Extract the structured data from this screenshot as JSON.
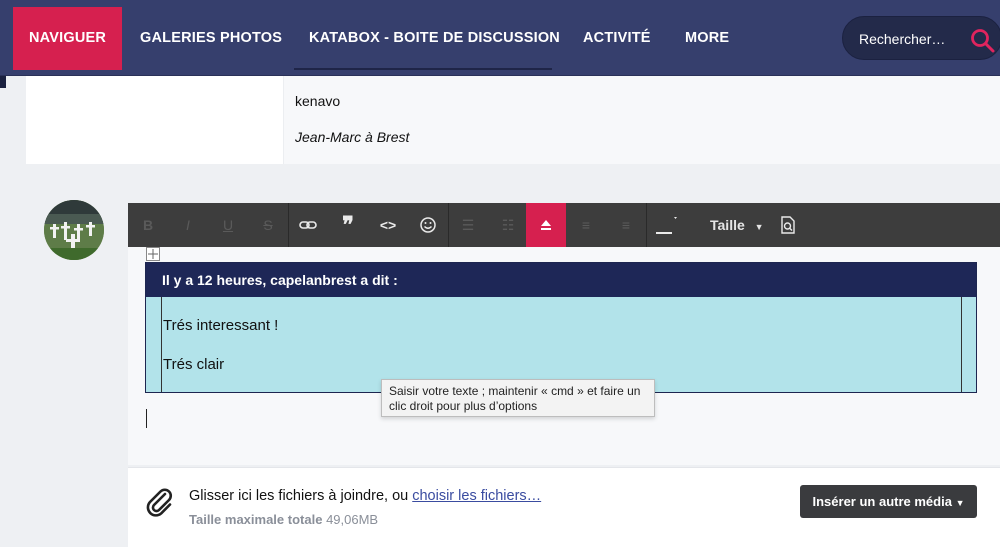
{
  "nav": {
    "items": [
      {
        "label": "NAVIGUER"
      },
      {
        "label": "GALERIES PHOTOS"
      },
      {
        "label": "KATABOX - BOITE DE DISCUSSION"
      },
      {
        "label": "ACTIVITÉ"
      },
      {
        "label": "MORE"
      }
    ],
    "search_placeholder": "Rechercher…",
    "accent": "#d6204f",
    "bar_color": "#363f6d"
  },
  "previous_post": {
    "line1": "kenavo",
    "line2": "Jean-Marc à Brest"
  },
  "editor": {
    "toolbar": {
      "size_label": "Taille",
      "icons": [
        "bold-icon",
        "italic-icon",
        "underline-icon",
        "strikethrough-icon",
        "link-icon",
        "quote-icon",
        "code-icon",
        "emoji-icon",
        "list-icon",
        "numbered-list-icon",
        "align-center-icon",
        "align-left-icon",
        "align-right-icon",
        "text-color-icon",
        "size-dropdown",
        "preview-icon"
      ]
    },
    "quote": {
      "header": "Il y a 12 heures, capelanbrest a dit :",
      "lines": [
        "Trés interessant !",
        "Trés clair"
      ]
    },
    "tooltip": "Saisir votre texte ; maintenir « cmd » et faire un clic droit pour plus d’options"
  },
  "attachments": {
    "drop_text": "Glisser ici les fichiers à joindre, ou",
    "choose_link": "choisir les fichiers…",
    "max_label": "Taille maximale totale",
    "max_value": "49,06MB",
    "media_button": "Insérer un autre média"
  }
}
